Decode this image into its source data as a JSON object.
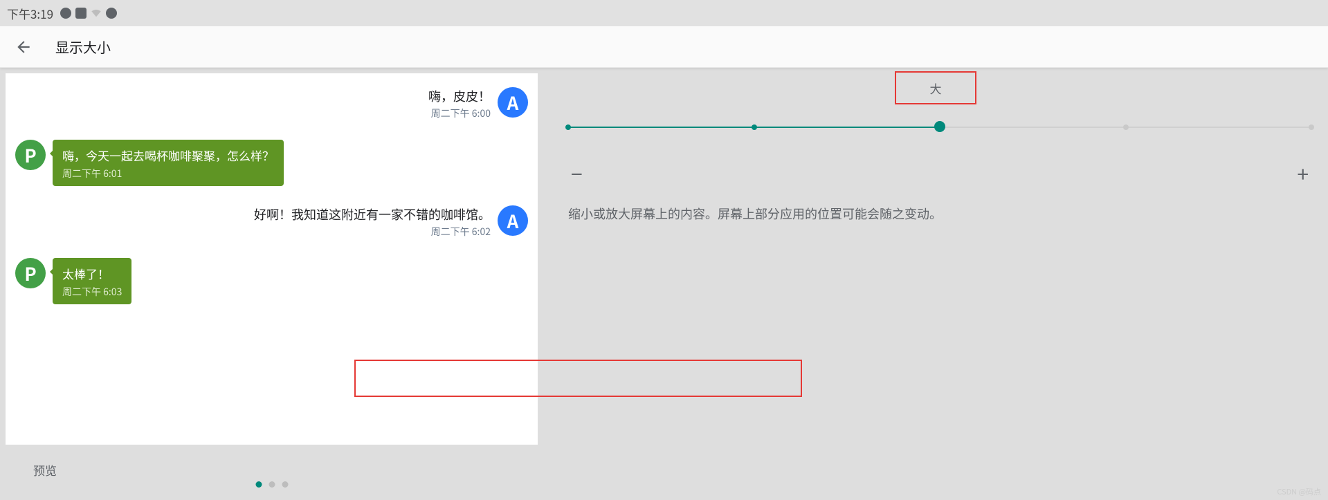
{
  "status_bar": {
    "time": "下午3:19"
  },
  "app_bar": {
    "title": "显示大小"
  },
  "chat": {
    "avatar_a": "A",
    "avatar_p": "P",
    "m1_text": "嗨，皮皮！",
    "m1_time": "周二下午 6:00",
    "m2_text": "嗨，今天一起去喝杯咖啡聚聚，怎么样？",
    "m2_time": "周二下午 6:01",
    "m3_text": "好啊！我知道这附近有一家不错的咖啡馆。",
    "m3_time": "周二下午 6:02",
    "m4_text": "太棒了！",
    "m4_time": "周二下午 6:03"
  },
  "preview_label": "预览",
  "slider": {
    "current_label": "大",
    "minus": "−",
    "plus": "+",
    "ticks_total": 5,
    "current_index": 2,
    "tick_positions_pct": [
      0,
      25,
      50,
      75,
      100
    ]
  },
  "description": "缩小或放大屏幕上的内容。屏幕上部分应用的位置可能会随之变动。",
  "watermark": "CSDN @码点"
}
